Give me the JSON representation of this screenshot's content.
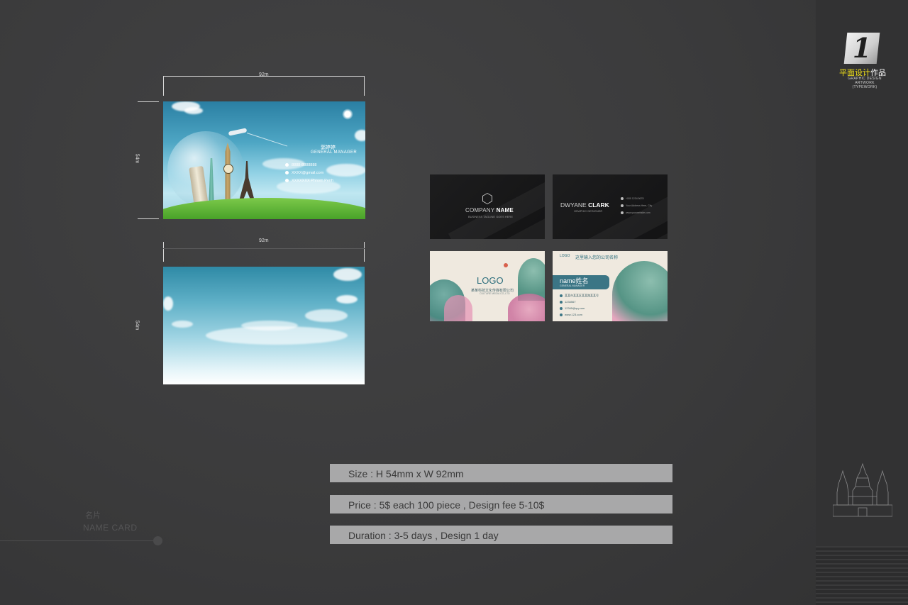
{
  "branding": {
    "logo_number": "1",
    "logo_title_highlight": "平面设计",
    "logo_title_rest": "作品",
    "logo_subtitle": "GRAPHIC DESIGN ARTWORK",
    "logo_subtitle2": "(TYPEWORK)"
  },
  "dimensions": {
    "width_label": "92m",
    "height_label": "54m"
  },
  "card_front": {
    "name": "郭婷婷",
    "title": "GENERAL MANAGER",
    "rows": [
      "8888-8888888",
      "XXXX@gmail.com",
      "XXXXXXX Phnom Penh"
    ]
  },
  "dark_card_front": {
    "company_light": "COMPANY",
    "company_bold": "NAME",
    "tagline": "BUSINESS TAGLINE GOES HERE"
  },
  "dark_card_back": {
    "first_name": "DWYANE",
    "last_name": "CLARK",
    "role": "GRAPHIC DESIGNER",
    "lines": [
      "+000 1234 5678",
      "Your Address Here, City",
      "www.yourwebsite.com"
    ]
  },
  "ink_card_front": {
    "logo": "LOGO",
    "subtitle": "某某科技文化传媒有限公司",
    "subtitle2": "CULTURE MEDIA CO.,LTD"
  },
  "ink_card_back": {
    "top_logo": "LOGO",
    "top_company": "这里输入您的公司名称",
    "name": "name姓名",
    "role": "GENERAL MANAGER",
    "rows": [
      "某某市某某区某某路某某号",
      "1234567",
      "12345@qq.com",
      "www.123.com"
    ]
  },
  "info": {
    "size": "Size : H 54mm x W 92mm",
    "price": "Price :  5$ each 100 piece ,  Design fee 5-10$",
    "duration": "Duration :  3-5 days , Design 1 day"
  },
  "caption": {
    "cn": "名片",
    "en": "NAME CARD"
  }
}
